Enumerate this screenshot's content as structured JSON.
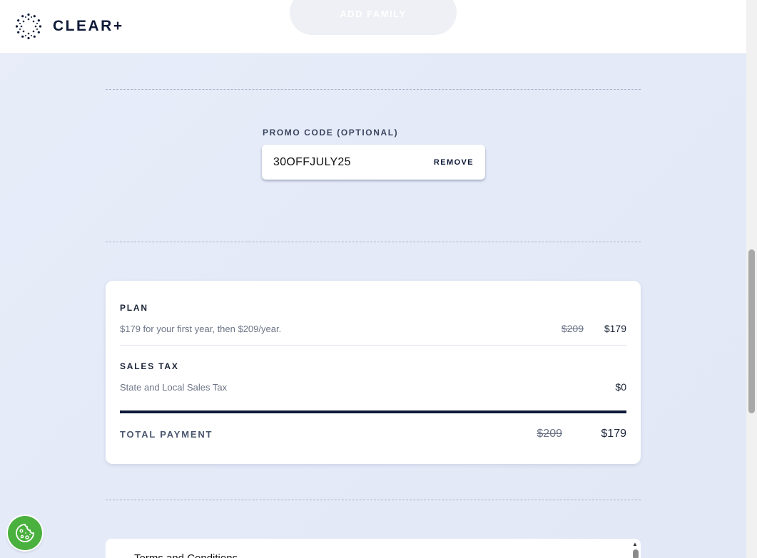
{
  "header": {
    "logo_text": "CLEAR+",
    "add_family_label": "ADD FAMILY"
  },
  "promo": {
    "label": "PROMO CODE (OPTIONAL)",
    "value": "30OFFJULY25",
    "remove_label": "REMOVE"
  },
  "summary": {
    "plan_title": "PLAN",
    "plan_desc": "$179 for your first year, then $209/year.",
    "plan_original": "$209",
    "plan_price": "$179",
    "tax_title": "SALES TAX",
    "tax_desc": "State and Local Sales Tax",
    "tax_amount": "$0",
    "total_label": "TOTAL PAYMENT",
    "total_original": "$209",
    "total_price": "$179"
  },
  "terms": {
    "title": "Terms and Conditions"
  },
  "colors": {
    "navy": "#0e1a38",
    "cookie_green": "#4ab03e",
    "background": "#e6ebf8"
  },
  "icons": {
    "logo": "clear-dots-ring-icon",
    "cookie": "cookie-icon"
  }
}
